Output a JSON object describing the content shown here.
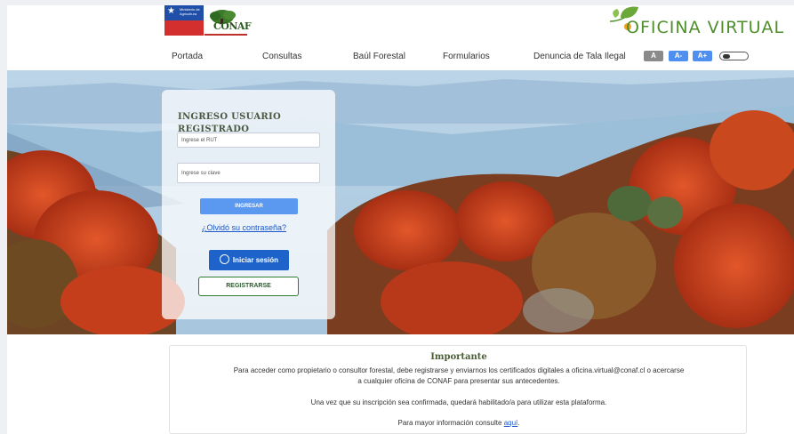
{
  "header": {
    "gov_logo_text": "Ministerio de Agricultura",
    "conaf_logo_text": "CONAF",
    "app_title": "OFICINA VIRTUAL",
    "nav": [
      {
        "label": "Portada"
      },
      {
        "label": "Consultas"
      },
      {
        "label": "Baúl Forestal"
      },
      {
        "label": "Formularios"
      },
      {
        "label": "Denuncia de Tala Ilegal"
      }
    ],
    "font_controls": {
      "normal": "A",
      "smaller": "A-",
      "larger": "A+"
    }
  },
  "login": {
    "title": "INGRESO USUARIO REGISTRADO",
    "rut_placeholder": "Ingrese el RUT",
    "password_placeholder": "Ingrese su clave",
    "submit_label": "INGRESAR",
    "forgot_label": "¿Olvidó su contraseña?",
    "clave_unica_label": "Iniciar sesión",
    "register_label": "REGISTRARSE"
  },
  "info": {
    "title": "Importante",
    "line1": "Para acceder como propietario o consultor forestal, debe registrarse y enviarnos los certificados digitales a oficina.virtual@conaf.cl o acercarse",
    "line2": "a cualquier oficina de CONAF para presentar sus antecedentes.",
    "line3": "Una vez que su inscripción sea confirmada, quedará habilitado/a para utilizar esta plataforma.",
    "line4_prefix": "Para mayor información consulte",
    "line4_link": "aquí",
    "line4_suffix": "."
  },
  "colors": {
    "brand_green": "#4e8f2c",
    "primary_blue": "#5b98f0",
    "clave_unica_blue": "#1e63c9",
    "font_btn_gray": "#8a8a8a",
    "font_btn_blue": "#4f8ff0"
  }
}
